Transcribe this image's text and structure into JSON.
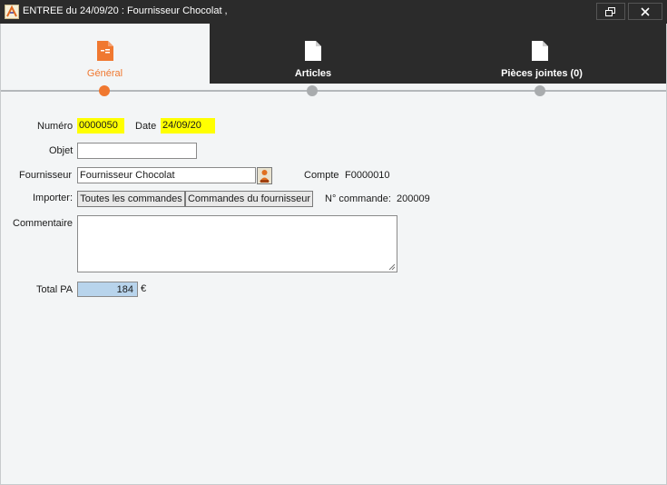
{
  "window": {
    "title": "ENTREE du 24/09/20 : Fournisseur Chocolat ,",
    "restore_glyph": "🗗",
    "close_glyph": "✕"
  },
  "tabs": [
    {
      "label": "Général",
      "icon": "document-icon",
      "active": true
    },
    {
      "label": "Articles",
      "icon": "document-icon",
      "active": false
    },
    {
      "label": "Pièces jointes (0)",
      "icon": "document-icon",
      "active": false
    }
  ],
  "form": {
    "numero_label": "Numéro",
    "numero_value": "0000050",
    "date_label": "Date",
    "date_value": "24/09/20",
    "objet_label": "Objet",
    "objet_value": "",
    "fournisseur_label": "Fournisseur",
    "fournisseur_value": "Fournisseur Chocolat",
    "compte_label": "Compte",
    "compte_value": "F0000010",
    "importer_label": "Importer:",
    "btn_toutes": "Toutes les commandes",
    "btn_fournisseur": "Commandes du fournisseur",
    "ncommande_label": "N° commande:",
    "ncommande_value": "200009",
    "commentaire_label": "Commentaire",
    "commentaire_value": "",
    "total_label": "Total PA",
    "total_value": "184",
    "currency": "€"
  },
  "colors": {
    "accent": "#f07830",
    "dark_bar": "#2b2b2b",
    "highlight_yellow": "#ffff00",
    "total_blue": "#b8d4ec"
  }
}
